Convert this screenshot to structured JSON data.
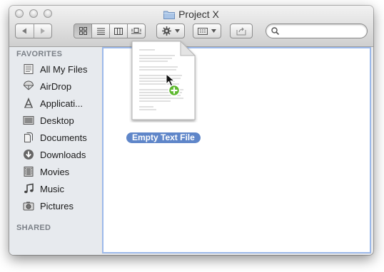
{
  "window": {
    "title": "Project X"
  },
  "toolbar": {
    "view_modes": [
      "icon-view",
      "list-view",
      "column-view",
      "cover-flow-view"
    ],
    "active_view": "icon-view",
    "search": {
      "placeholder": "",
      "value": ""
    }
  },
  "sidebar": {
    "favorites_heading": "FAVORITES",
    "items": [
      {
        "label": "All My Files",
        "icon": "all-my-files-icon"
      },
      {
        "label": "AirDrop",
        "icon": "airdrop-icon"
      },
      {
        "label": "Applicati...",
        "icon": "applications-icon"
      },
      {
        "label": "Desktop",
        "icon": "desktop-icon"
      },
      {
        "label": "Documents",
        "icon": "documents-icon"
      },
      {
        "label": "Downloads",
        "icon": "downloads-icon"
      },
      {
        "label": "Movies",
        "icon": "movies-icon"
      },
      {
        "label": "Music",
        "icon": "music-icon"
      },
      {
        "label": "Pictures",
        "icon": "pictures-icon"
      }
    ],
    "shared_heading": "SHARED"
  },
  "content": {
    "file": {
      "name": "Empty Text File",
      "selected": true,
      "icon": "text-document-icon"
    },
    "drag_badge": "plus-copy-badge"
  },
  "colors": {
    "selection": "#5f86c9",
    "focus_ring": "#9cb9ea",
    "copy_badge": "#5db82e"
  }
}
